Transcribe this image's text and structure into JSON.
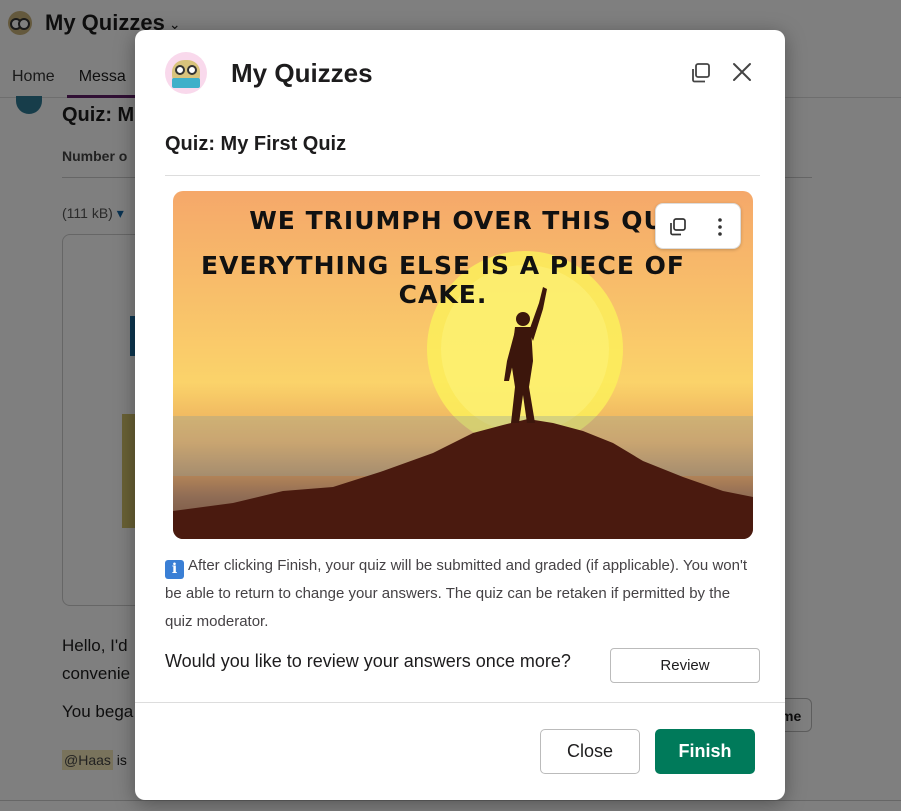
{
  "app": {
    "title": "My Quizzes",
    "tabs": [
      {
        "label": "Home"
      },
      {
        "label": "Messa"
      }
    ],
    "quiz_title": "Quiz: M",
    "number_label": "Number o",
    "file_size": "(111 kB)",
    "message_line1": "Hello, I'd",
    "message_line2": "convenie",
    "began_text": "You bega",
    "mention": "@Haas",
    "mention_suffix": "is",
    "side_button": "me"
  },
  "modal": {
    "title": "My Quizzes",
    "quiz_heading": "Quiz: My First Quiz",
    "image": {
      "caption_line1": "WE TRIUMPH OVER THIS QUIZ.",
      "caption_line2": "EVERYTHING ELSE IS A PIECE OF CAKE."
    },
    "info_text": "After clicking Finish, your quiz will be submitted and graded (if applicable). You won't be able to return to change your answers. The quiz can be retaken if permitted by the quiz moderator.",
    "info_icon": "i",
    "review_question": "Would you like to review your answers once more?",
    "review_label": "Review",
    "close_label": "Close",
    "finish_label": "Finish"
  },
  "colors": {
    "finish": "#007a5a",
    "overlay": "rgba(0,0,0,0.5)",
    "active_tab": "#611f69"
  }
}
